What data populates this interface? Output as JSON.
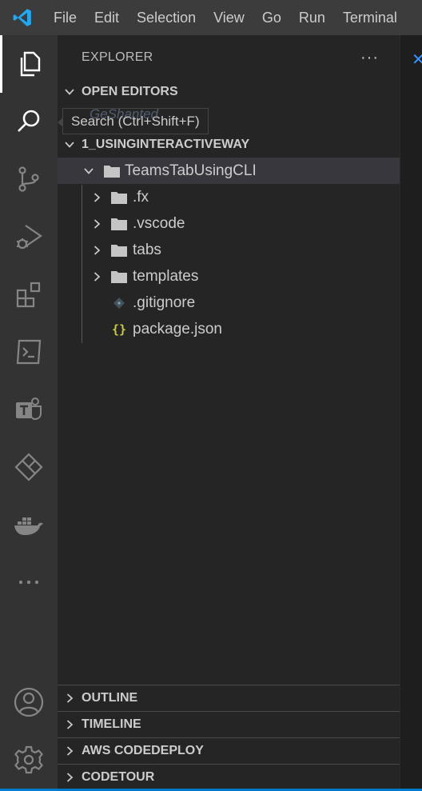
{
  "menu": {
    "items": [
      "File",
      "Edit",
      "Selection",
      "View",
      "Go",
      "Run",
      "Terminal"
    ]
  },
  "icons": {
    "app_logo": "vscode-logo-icon",
    "activity": [
      "files-icon",
      "search-icon",
      "source-control-icon",
      "run-debug-icon",
      "extensions-icon",
      "terminal-icon",
      "teams-icon",
      "power-platform-icon",
      "docker-icon",
      "more-icon",
      "account-icon",
      "settings-gear-icon"
    ]
  },
  "tooltip": {
    "text": "Search (Ctrl+Shift+F)",
    "watermark": "GeShanted"
  },
  "explorer": {
    "title": "EXPLORER",
    "more": "···",
    "open_editors": "OPEN EDITORS",
    "workspace": "1_USINGINTERACTIVEWAY",
    "project": "TeamsTabUsingCLI",
    "children": [
      {
        "label": ".fx",
        "type": "folder"
      },
      {
        "label": ".vscode",
        "type": "folder"
      },
      {
        "label": "tabs",
        "type": "folder"
      },
      {
        "label": "templates",
        "type": "folder"
      },
      {
        "label": ".gitignore",
        "type": "file"
      },
      {
        "label": "package.json",
        "type": "json"
      }
    ]
  },
  "bottom_sections": [
    "OUTLINE",
    "TIMELINE",
    "AWS CODEDEPLOY",
    "CODETOUR"
  ],
  "colors": {
    "titlebar": "#3c3c3c",
    "activitybar": "#333333",
    "sidebar": "#252526",
    "selected_row": "#37373d",
    "accent": "#007acc",
    "json_brace": "#cbcb41",
    "git_icon": "#41535b"
  }
}
